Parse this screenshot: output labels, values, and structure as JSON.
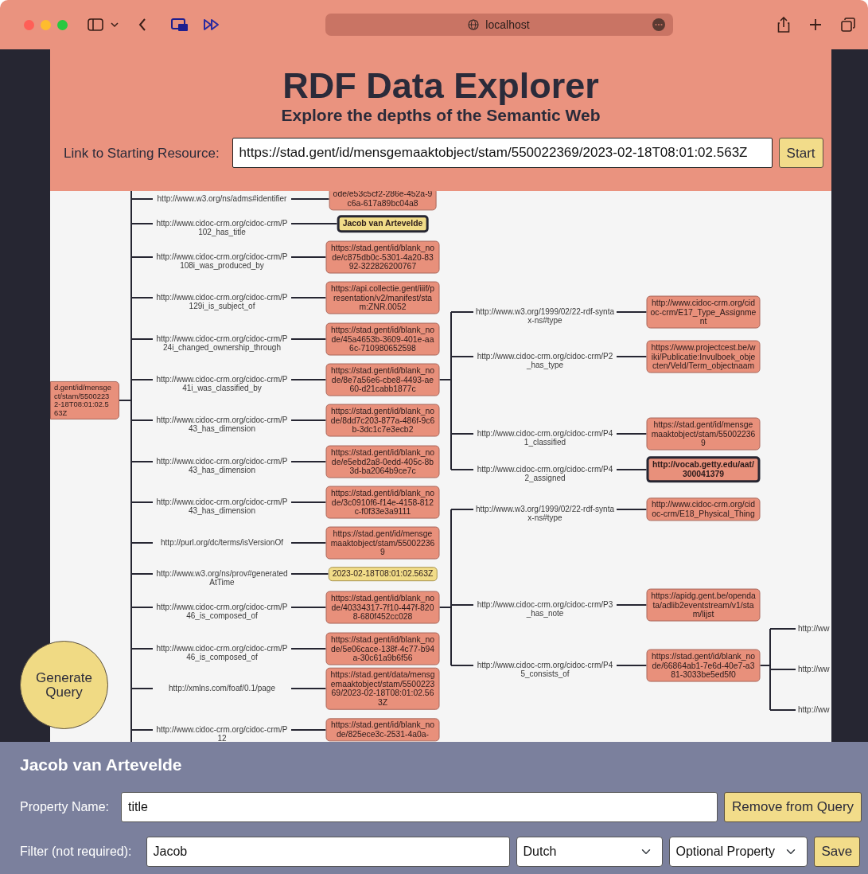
{
  "browser": {
    "address": "localhost"
  },
  "header": {
    "title": "RDF Data Explorer",
    "subtitle": "Explore the depths of the Semantic Web",
    "start_label": "Link to Starting Resource:",
    "start_value": "https://stad.gent/id/mensgemaaktobject/stam/550022369/2023-02-18T08:01:02.563Z",
    "start_button": "Start"
  },
  "graph": {
    "root": {
      "text": "d.gent/id/mensge\nct/stam/5500223\n2-18T08:01:02.5\n63Z",
      "kind": "uri",
      "selected": false,
      "children": [
        {
          "predicate": "http://www.w3.org/ns/adms#identifier",
          "node": {
            "text": "ode/e53c5cf2-286e-452a-9\nc6a-617a89bc04a8",
            "kind": "uri",
            "selected": false
          }
        },
        {
          "predicate": "http://www.cidoc-crm.org/cidoc-crm/P102_has_title",
          "node": {
            "text": "Jacob van Artevelde",
            "kind": "literal",
            "selected": true
          }
        },
        {
          "predicate": "http://www.cidoc-crm.org/cidoc-crm/P108i_was_produced_by",
          "node": {
            "text": "https://stad.gent/id/blank_node/c875db0c-5301-4a20-8392-322826200767",
            "kind": "uri",
            "selected": false
          }
        },
        {
          "predicate": "http://www.cidoc-crm.org/cidoc-crm/P129i_is_subject_of",
          "node": {
            "text": "https://api.collectie.gent/iiif/presentation/v2/manifest/stam:ZNR.0052",
            "kind": "uri",
            "selected": false
          }
        },
        {
          "predicate": "http://www.cidoc-crm.org/cidoc-crm/P24i_changed_ownership_through",
          "node": {
            "text": "https://stad.gent/id/blank_node/45a4653b-3609-401e-aa6c-710980652598",
            "kind": "uri",
            "selected": false
          }
        },
        {
          "predicate": "http://www.cidoc-crm.org/cidoc-crm/P41i_was_classified_by",
          "node": {
            "text": "https://stad.gent/id/blank_node/8e7a56e6-cbe8-4493-ae60-d21cabb1877c",
            "kind": "uri",
            "selected": false,
            "children": [
              {
                "predicate": "http://www.w3.org/1999/02/22-rdf-syntax-ns#type",
                "node": {
                  "text": "http://www.cidoc-crm.org/cidoc-crm/E17_Type_Assignment",
                  "kind": "uri",
                  "selected": false
                }
              },
              {
                "predicate": "http://www.cidoc-crm.org/cidoc-crm/P2_has_type",
                "node": {
                  "text": "https://www.projectcest.be/wiki/Publicatie:Invulboek_objecten/Veld/Term_objectnaam",
                  "kind": "uri",
                  "selected": false
                }
              },
              {
                "predicate": "http://www.cidoc-crm.org/cidoc-crm/P41_classified",
                "node": {
                  "text": "https://stad.gent/id/mensgemaaktobject/stam/550022369",
                  "kind": "uri",
                  "selected": false
                }
              },
              {
                "predicate": "http://www.cidoc-crm.org/cidoc-crm/P42_assigned",
                "node": {
                  "text": "http://vocab.getty.edu/aat/300041379",
                  "kind": "uri",
                  "selected": true
                }
              }
            ]
          }
        },
        {
          "predicate": "http://www.cidoc-crm.org/cidoc-crm/P43_has_dimension",
          "node": {
            "text": "https://stad.gent/id/blank_node/8dd7c203-877a-486f-9c6b-3dc1c7e3ecb2",
            "kind": "uri",
            "selected": false
          }
        },
        {
          "predicate": "http://www.cidoc-crm.org/cidoc-crm/P43_has_dimension",
          "node": {
            "text": "https://stad.gent/id/blank_node/e5ebd2a8-0edd-405c-8b3d-ba2064b9ce7c",
            "kind": "uri",
            "selected": false
          }
        },
        {
          "predicate": "http://www.cidoc-crm.org/cidoc-crm/P43_has_dimension",
          "node": {
            "text": "https://stad.gent/id/blank_node/3c0910f6-f14e-4158-812c-f0f33e3a9111",
            "kind": "uri",
            "selected": false
          }
        },
        {
          "predicate": "http://purl.org/dc/terms/isVersionOf",
          "node": {
            "text": "https://stad.gent/id/mensgemaaktobject/stam/550022369",
            "kind": "uri",
            "selected": false
          }
        },
        {
          "predicate": "http://www.w3.org/ns/prov#generatedAtTime",
          "node": {
            "text": "2023-02-18T08:01:02.563Z",
            "kind": "literal",
            "selected": false
          }
        },
        {
          "predicate": "http://www.cidoc-crm.org/cidoc-crm/P46_is_composed_of",
          "node": {
            "text": "https://stad.gent/id/blank_node/40334317-7f10-447f-8208-680f452cc028",
            "kind": "uri",
            "selected": false,
            "children": [
              {
                "predicate": "http://www.w3.org/1999/02/22-rdf-syntax-ns#type",
                "node": {
                  "text": "http://www.cidoc-crm.org/cidoc-crm/E18_Physical_Thing",
                  "kind": "uri",
                  "selected": false
                }
              },
              {
                "predicate": "http://www.cidoc-crm.org/cidoc-crm/P3_has_note",
                "node": {
                  "text": "https://apidg.gent.be/opendata/adlib2eventstream/v1/stam/lijst",
                  "kind": "uri",
                  "selected": false
                }
              },
              {
                "predicate": "http://www.cidoc-crm.org/cidoc-crm/P45_consists_of",
                "node": {
                  "text": "https://stad.gent/id/blank_node/66864ab1-7e6d-40e7-a381-3033be5ed5f0",
                  "kind": "uri",
                  "selected": false,
                  "children": [
                    {
                      "predicate": "http://ww"
                    },
                    {
                      "predicate": "http://ww"
                    },
                    {
                      "predicate": "http://ww"
                    }
                  ]
                }
              }
            ]
          }
        },
        {
          "predicate": "http://www.cidoc-crm.org/cidoc-crm/P46_is_composed_of",
          "node": {
            "text": "https://stad.gent/id/blank_node/5e06cace-138f-4c77-b94a-30c61a9b6f56",
            "kind": "uri",
            "selected": false
          }
        },
        {
          "predicate": "http://xmlns.com/foaf/0.1/page",
          "node": {
            "text": "https://stad.gent/data/mensgemaaktobject/stam/550022369/2023-02-18T08:01:02.563Z",
            "kind": "uri",
            "selected": false
          }
        },
        {
          "predicate": "http://www.cidoc-crm.org/cidoc-crm/P12",
          "node": {
            "text": "https://stad.gent/id/blank_node/825ece3c-2531-4a0a-",
            "kind": "uri",
            "selected": false
          }
        }
      ]
    }
  },
  "generate_button": "Generate Query",
  "panel": {
    "title": "Jacob van Artevelde",
    "property_label": "Property Name:",
    "property_value": "title",
    "remove_button": "Remove from Query",
    "filter_label": "Filter (not required):",
    "filter_value": "Jacob",
    "language": "Dutch",
    "optionality": "Optional Property",
    "save_button": "Save"
  }
}
